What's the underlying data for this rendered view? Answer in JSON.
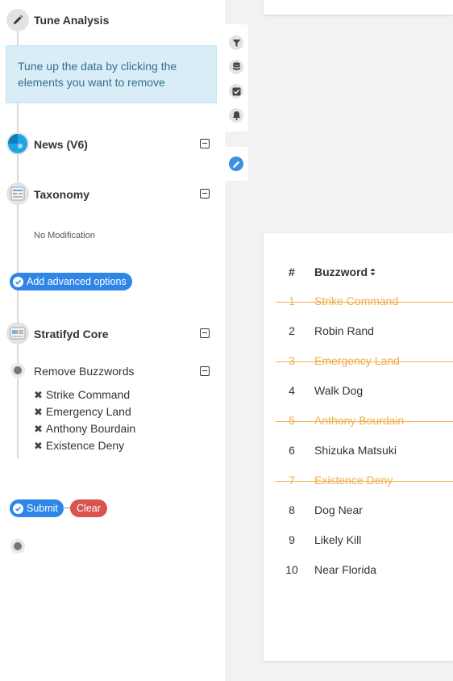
{
  "tune_analysis": {
    "title": "Tune Analysis",
    "info": "Tune up the data by clicking the elements you want to remove"
  },
  "news": {
    "title": "News (V6)"
  },
  "taxonomy": {
    "title": "Taxonomy",
    "status": "No Modification",
    "advanced_label": "Add advanced options"
  },
  "core": {
    "title": "Stratifyd Core",
    "remove_title": "Remove Buzzwords",
    "removed": [
      "Strike Command",
      "Emergency Land",
      "Anthony Bourdain",
      "Existence Deny"
    ]
  },
  "actions": {
    "submit_label": "Submit",
    "clear_label": "Clear"
  },
  "toolbar": {
    "icons": [
      "filter-icon",
      "database-icon",
      "checkbox-icon",
      "bell-icon",
      "pencil-icon"
    ]
  },
  "table": {
    "col_num": "#",
    "col_word": "Buzzword",
    "rows": [
      {
        "n": "1",
        "word": "Strike Command",
        "removed": true
      },
      {
        "n": "2",
        "word": "Robin Rand",
        "removed": false
      },
      {
        "n": "3",
        "word": "Emergency Land",
        "removed": true
      },
      {
        "n": "4",
        "word": "Walk Dog",
        "removed": false
      },
      {
        "n": "5",
        "word": "Anthony Bourdain",
        "removed": true
      },
      {
        "n": "6",
        "word": "Shizuka Matsuki",
        "removed": false
      },
      {
        "n": "7",
        "word": "Existence Deny",
        "removed": true
      },
      {
        "n": "8",
        "word": "Dog Near",
        "removed": false
      },
      {
        "n": "9",
        "word": "Likely Kill",
        "removed": false
      },
      {
        "n": "10",
        "word": "Near Florida",
        "removed": false
      }
    ]
  },
  "colors": {
    "accent": "#2f86e8",
    "danger": "#d9534f",
    "removed": "#f0ad4e",
    "info_bg": "#d9edf7"
  }
}
